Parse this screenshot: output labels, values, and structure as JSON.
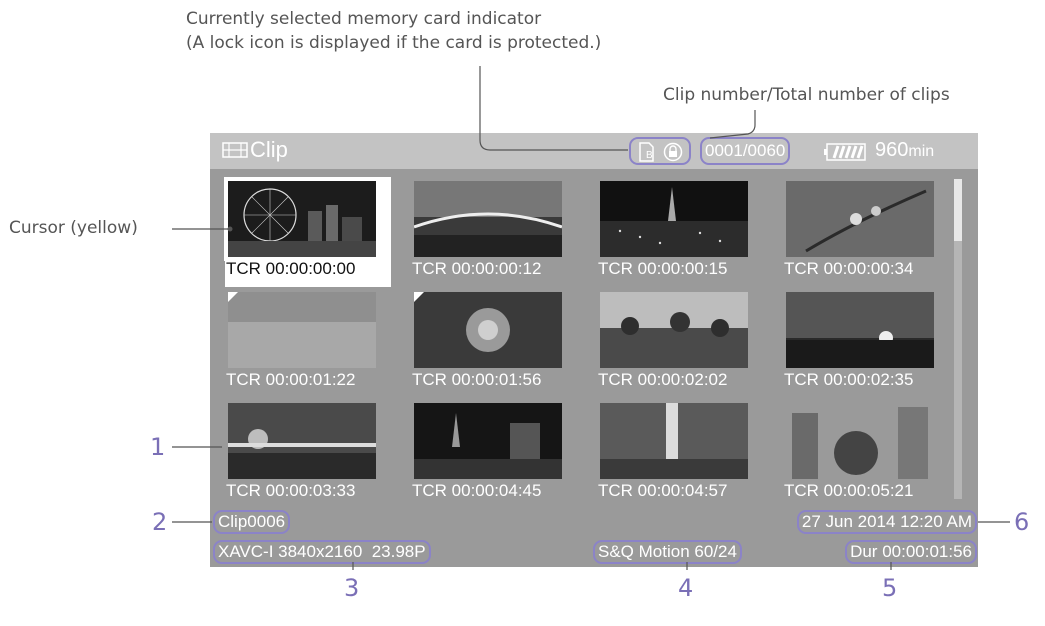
{
  "callouts": {
    "media_indicator_line1": "Currently selected memory card indicator",
    "media_indicator_line2": "(A lock icon is displayed if the card is protected.)",
    "clip_number": "Clip number/Total number of clips",
    "cursor": "Cursor (yellow)",
    "n1": "1",
    "n2": "2",
    "n3": "3",
    "n4": "4",
    "n5": "5",
    "n6": "6"
  },
  "screen": {
    "title": "Clip",
    "title_icon": "film-strip-icon",
    "media_icons": [
      "card-b-icon",
      "lock-icon"
    ],
    "clip_counter": "0001/0060",
    "battery_remaining": "960",
    "battery_unit": "min",
    "scroll_position": 0,
    "clips": [
      {
        "tc": "TCR 00:00:00:00",
        "scene": "night ferris wheel"
      },
      {
        "tc": "TCR 00:00:00:12",
        "scene": "illuminated bridge"
      },
      {
        "tc": "TCR 00:00:00:15",
        "scene": "city night with tower"
      },
      {
        "tc": "TCR 00:00:00:34",
        "scene": "blossom branch"
      },
      {
        "tc": "TCR 00:00:01:22",
        "scene": "grass field"
      },
      {
        "tc": "TCR 00:00:01:56",
        "scene": "spider lily flowers"
      },
      {
        "tc": "TCR 00:00:02:02",
        "scene": "sunflowers"
      },
      {
        "tc": "TCR 00:00:02:35",
        "scene": "sunset horizon"
      },
      {
        "tc": "TCR 00:00:03:33",
        "scene": "sun over sea"
      },
      {
        "tc": "TCR 00:00:04:45",
        "scene": "night skyline"
      },
      {
        "tc": "TCR 00:00:04:57",
        "scene": "waterfall"
      },
      {
        "tc": "TCR 00:00:05:21",
        "scene": "trees and buildings"
      }
    ],
    "clip_name": "Clip0006",
    "datetime": "27 Jun 2014 12:20 AM",
    "format": "XAVC-I 3840x2160  23.98P",
    "special_recording": "S&Q Motion 60/24",
    "duration": "Dur 00:00:01:56"
  },
  "colors": {
    "callout_accent": "#8b83c8",
    "screen_bg": "#9a9a9a",
    "topbar_bg": "#c3c3c3"
  }
}
